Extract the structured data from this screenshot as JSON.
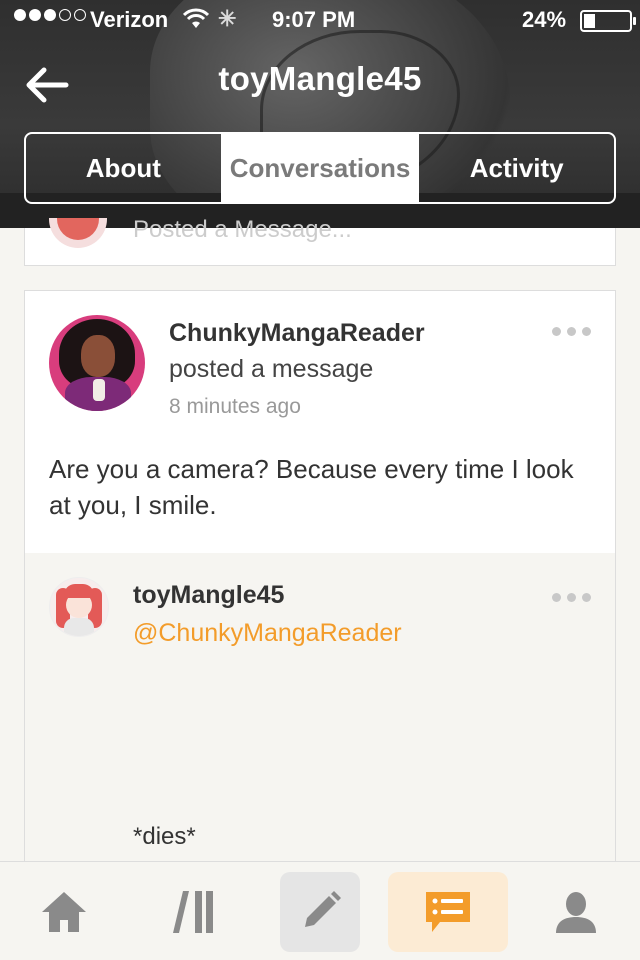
{
  "status_bar": {
    "carrier": "Verizon",
    "time": "9:07 PM",
    "battery": "24%",
    "battery_level": 0.24
  },
  "header": {
    "title": "toyMangle45",
    "tabs": [
      {
        "label": "About",
        "active": false
      },
      {
        "label": "Conversations",
        "active": true
      },
      {
        "label": "Activity",
        "active": false
      }
    ]
  },
  "previous_post": {
    "faded_text": "Posted a Message..."
  },
  "post": {
    "author": "ChunkyMangaReader",
    "action": "posted a message",
    "time_ago": "8 minutes ago",
    "body": "Are you a camera? Because every time I look at you, I smile."
  },
  "reply": {
    "author": "toyMangle45",
    "mention": "@ChunkyMangaReader",
    "text": "*dies*"
  },
  "bottom_nav": {
    "items": [
      "home-icon",
      "library-icon",
      "compose-icon",
      "messages-icon",
      "profile-icon"
    ],
    "active": "messages-icon",
    "accent": "#f39c2a"
  },
  "colors": {
    "accent": "#f39c2a",
    "header_bg": "#333333"
  }
}
